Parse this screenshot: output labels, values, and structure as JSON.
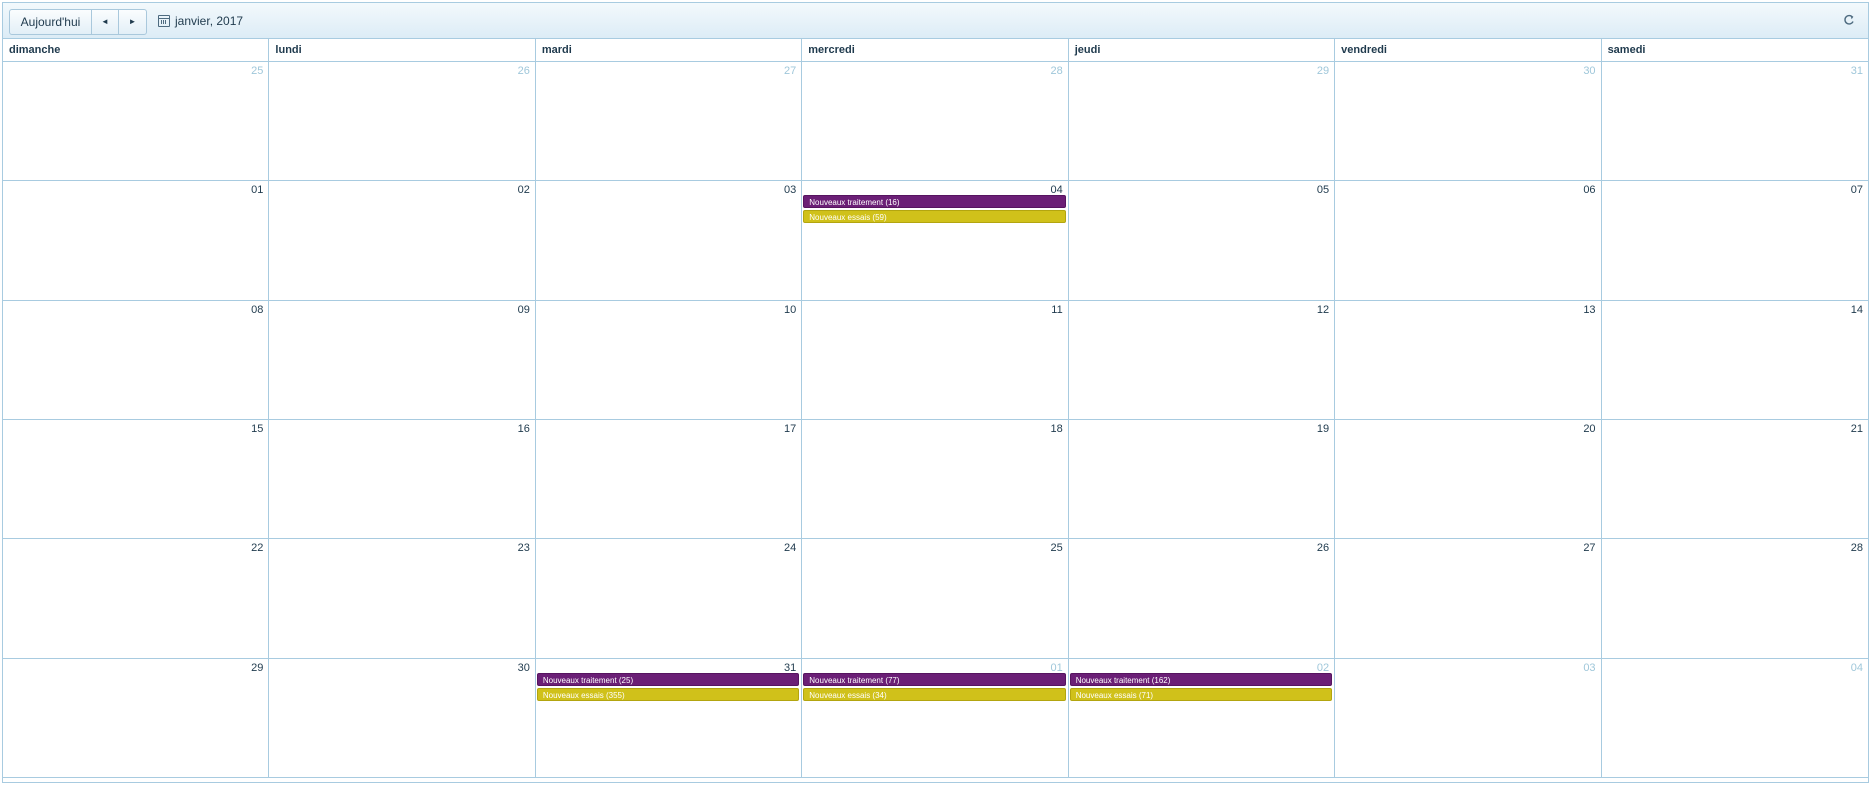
{
  "toolbar": {
    "today_label": "Aujourd'hui",
    "prev_label": "◄",
    "next_label": "►",
    "current_period": "janvier, 2017"
  },
  "weekdays": [
    "dimanche",
    "lundi",
    "mardi",
    "mercredi",
    "jeudi",
    "vendredi",
    "samedi"
  ],
  "colors": {
    "treatment": "#6b1f76",
    "essai": "#d0c11a",
    "border": "#a8cbe0",
    "other_month_text": "#9fc7da"
  },
  "weeks": [
    [
      {
        "day": "25",
        "other": true
      },
      {
        "day": "26",
        "other": true
      },
      {
        "day": "27",
        "other": true
      },
      {
        "day": "28",
        "other": true
      },
      {
        "day": "29",
        "other": true
      },
      {
        "day": "30",
        "other": true
      },
      {
        "day": "31",
        "other": true
      }
    ],
    [
      {
        "day": "01"
      },
      {
        "day": "02"
      },
      {
        "day": "03"
      },
      {
        "day": "04",
        "events": [
          {
            "type": "treat",
            "label": "Nouveaux traitement (16)"
          },
          {
            "type": "essai",
            "label": "Nouveaux essais (59)"
          }
        ]
      },
      {
        "day": "05"
      },
      {
        "day": "06"
      },
      {
        "day": "07"
      }
    ],
    [
      {
        "day": "08"
      },
      {
        "day": "09"
      },
      {
        "day": "10"
      },
      {
        "day": "11"
      },
      {
        "day": "12"
      },
      {
        "day": "13"
      },
      {
        "day": "14"
      }
    ],
    [
      {
        "day": "15"
      },
      {
        "day": "16"
      },
      {
        "day": "17"
      },
      {
        "day": "18"
      },
      {
        "day": "19"
      },
      {
        "day": "20"
      },
      {
        "day": "21"
      }
    ],
    [
      {
        "day": "22"
      },
      {
        "day": "23"
      },
      {
        "day": "24"
      },
      {
        "day": "25"
      },
      {
        "day": "26"
      },
      {
        "day": "27"
      },
      {
        "day": "28"
      }
    ],
    [
      {
        "day": "29"
      },
      {
        "day": "30"
      },
      {
        "day": "31",
        "events": [
          {
            "type": "treat",
            "label": "Nouveaux traitement (25)"
          },
          {
            "type": "essai",
            "label": "Nouveaux essais (355)"
          }
        ]
      },
      {
        "day": "01",
        "other": true,
        "events": [
          {
            "type": "treat",
            "label": "Nouveaux traitement (77)"
          },
          {
            "type": "essai",
            "label": "Nouveaux essais (34)"
          }
        ]
      },
      {
        "day": "02",
        "other": true,
        "events": [
          {
            "type": "treat",
            "label": "Nouveaux traitement (162)"
          },
          {
            "type": "essai",
            "label": "Nouveaux essais (71)"
          }
        ]
      },
      {
        "day": "03",
        "other": true
      },
      {
        "day": "04",
        "other": true
      }
    ]
  ]
}
